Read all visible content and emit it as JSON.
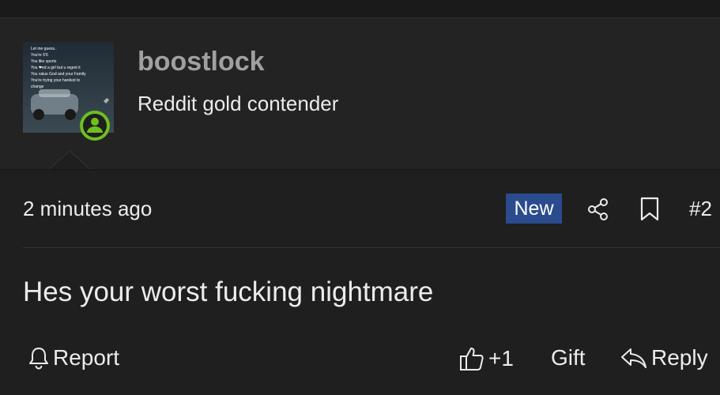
{
  "post": {
    "username": "boostlock",
    "user_title": "Reddit gold contender",
    "timestamp": "2 minutes ago",
    "badge": "New",
    "post_number": "#2",
    "body": "Hes your worst fucking nightmare",
    "avatar_text": [
      "Let me guess..",
      "You're 5'6",
      "You like sports",
      "You ❤ed a girl but u regret it",
      "You value God and your Family",
      "You're trying your hardest to",
      "change"
    ]
  },
  "actions": {
    "report": "Report",
    "like_count": "+1",
    "gift": "Gift",
    "reply": "Reply"
  },
  "icons": {
    "report": "bell-icon",
    "like": "thumbs-up-icon",
    "reply": "reply-icon",
    "share": "share-icon",
    "bookmark": "bookmark-icon",
    "presence": "user-online-icon"
  },
  "colors": {
    "background": "#1f1f1f",
    "header_background": "#232323",
    "badge": "#2b4b8f",
    "presence": "#6ec01f",
    "username": "#a0a0a0"
  }
}
